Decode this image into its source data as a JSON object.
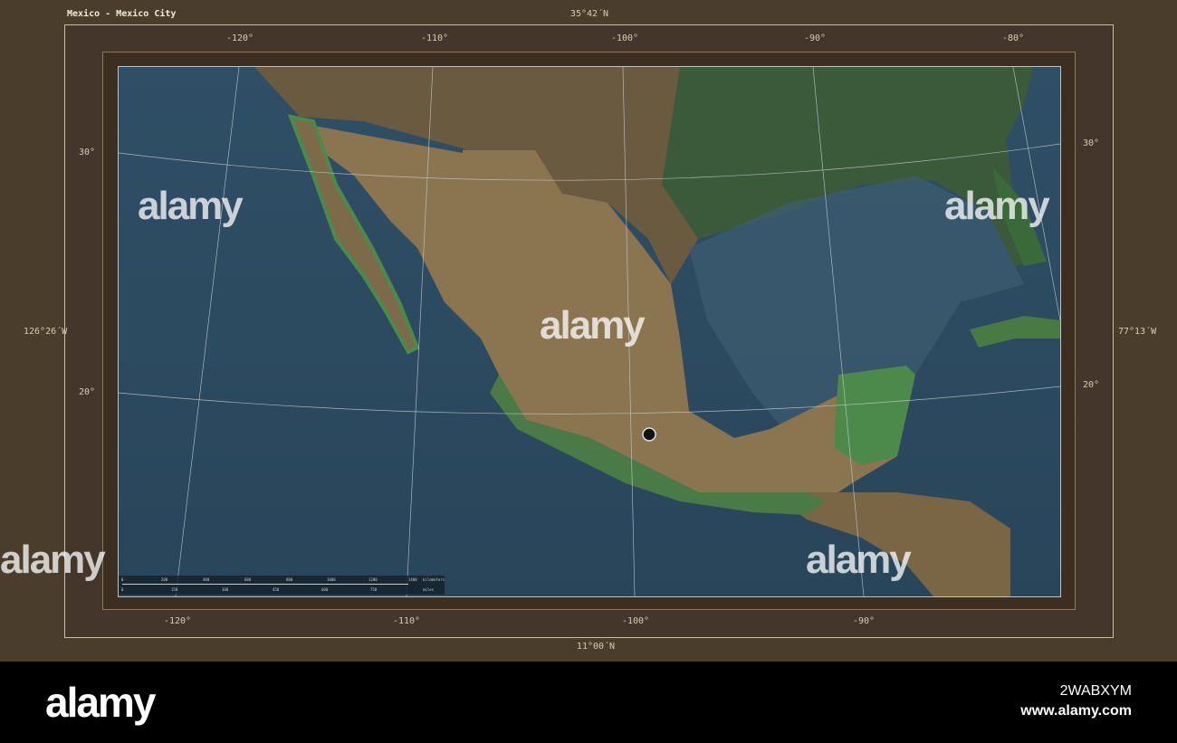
{
  "title": "Mexico - Mexico City",
  "lat_top": "35°42´N",
  "lat_bottom": "11°00´N",
  "lon_left": "126°26´W",
  "lon_right": "77°13´W",
  "top_ticks": [
    "-120°",
    "-110°",
    "-100°",
    "-90°",
    "-80°"
  ],
  "bottom_ticks": [
    "-120°",
    "-110°",
    "-100°",
    "-90°"
  ],
  "left_ticks": [
    "30°",
    "20°"
  ],
  "right_ticks": [
    "30°",
    "20°"
  ],
  "scale": {
    "km": [
      "0",
      "200",
      "400",
      "600",
      "800",
      "1000",
      "1200",
      "1400"
    ],
    "km_unit": "kilometers",
    "mi": [
      "0",
      "150",
      "300",
      "450",
      "600",
      "750"
    ],
    "mi_unit": "miles"
  },
  "marker": "Mexico City",
  "watermark": "alamy",
  "footer": {
    "logo": "alamy",
    "image_id": "2WABXYM",
    "url": "www.alamy.com"
  },
  "colors": {
    "ocean": "#2e4a5e",
    "land": "#8a7550",
    "lowland": "#3f7a4a",
    "frame": "#4b3d2b"
  }
}
